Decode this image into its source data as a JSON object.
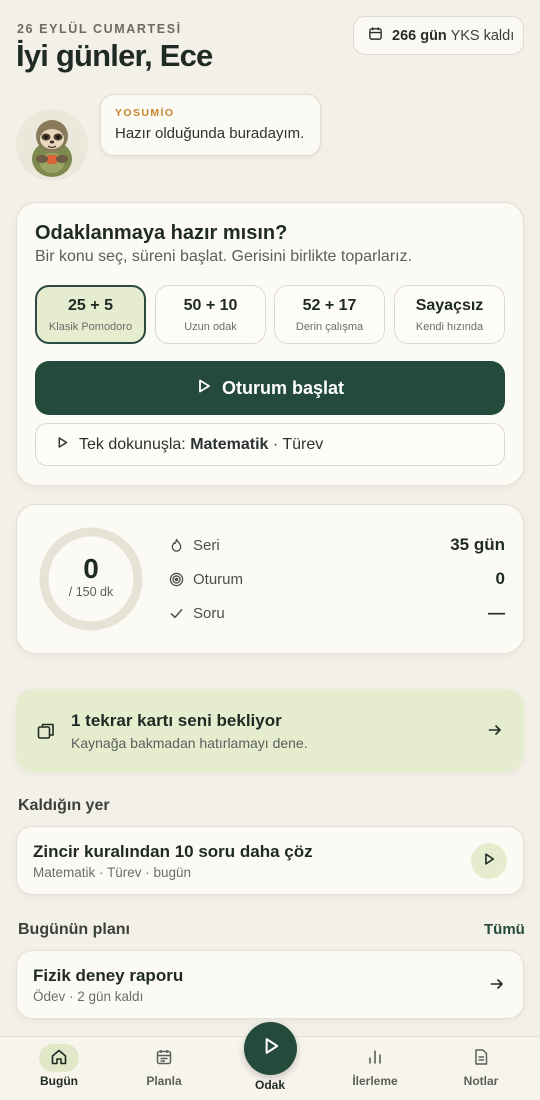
{
  "header": {
    "date": "26 EYLÜL CUMARTESİ",
    "greeting": "İyi günler, Ece",
    "countdown_value": "266 gün",
    "countdown_suffix": "YKS kaldı"
  },
  "mascot": {
    "name": "YOSUMİO",
    "message": "Hazır olduğunda buradayım."
  },
  "focus": {
    "title": "Odaklanmaya hazır mısın?",
    "subtitle": "Bir konu seç, süreni başlat. Gerisini birlikte toparlarız.",
    "modes": [
      {
        "title": "25 + 5",
        "subtitle": "Klasik Pomodoro",
        "active": true
      },
      {
        "title": "50 + 10",
        "subtitle": "Uzun odak",
        "active": false
      },
      {
        "title": "52 + 17",
        "subtitle": "Derin çalışma",
        "active": false
      },
      {
        "title": "Sayaçsız",
        "subtitle": "Kendi hızında",
        "active": false
      }
    ],
    "start_label": "Oturum başlat",
    "quick_prefix": "Tek dokunuşla:",
    "quick_subject": "Matematik",
    "quick_topic": "· Türev"
  },
  "stats": {
    "minutes_done": "0",
    "minutes_goal": "/ 150 dk",
    "progress_fraction": 0,
    "rows": [
      {
        "label": "Seri",
        "value": "35 gün",
        "icon": "flame-icon"
      },
      {
        "label": "Oturum",
        "value": "0",
        "icon": "target-icon"
      },
      {
        "label": "Soru",
        "value": "—",
        "icon": "check-icon"
      }
    ]
  },
  "review": {
    "title": "1 tekrar kartı seni bekliyor",
    "subtitle": "Kaynağa bakmadan hatırlamayı dene."
  },
  "resume": {
    "section_label": "Kaldığın yer",
    "title": "Zincir kuralından 10 soru daha çöz",
    "subtitle": "Matematik · Türev · bugün"
  },
  "plan": {
    "section_label": "Bugünün planı",
    "see_all": "Tümü",
    "title": "Fizik deney raporu",
    "subtitle": "Ödev · 2 gün kaldı"
  },
  "nav": {
    "items": [
      {
        "label": "Bugün",
        "icon": "home-icon"
      },
      {
        "label": "Planla",
        "icon": "calendar-icon"
      },
      {
        "label": "Odak",
        "icon": "play-icon"
      },
      {
        "label": "İlerleme",
        "icon": "bar-chart-icon"
      },
      {
        "label": "Notlar",
        "icon": "note-icon"
      }
    ]
  },
  "colors": {
    "primary": "#244a3c",
    "accent_light": "#e6edcf",
    "mascot_label": "#c9862c",
    "background": "#f3f0e8"
  }
}
